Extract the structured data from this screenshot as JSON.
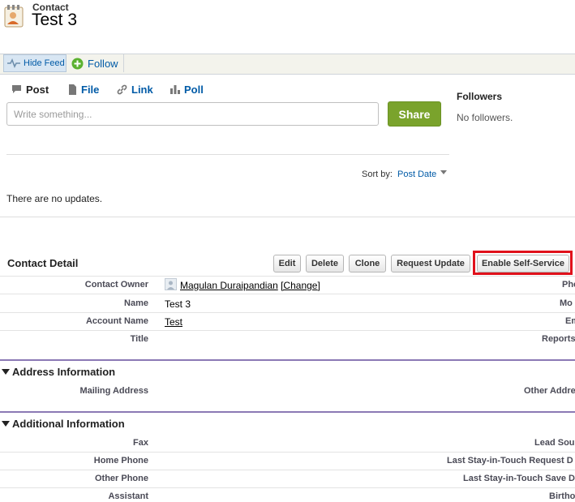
{
  "header": {
    "object_type": "Contact",
    "title": "Test 3"
  },
  "feed_bar": {
    "hide_feed": "Hide Feed",
    "follow": "Follow"
  },
  "publisher": {
    "tabs": [
      {
        "label": "Post"
      },
      {
        "label": "File"
      },
      {
        "label": "Link"
      },
      {
        "label": "Poll"
      }
    ],
    "placeholder": "Write something...",
    "share_label": "Share"
  },
  "followers": {
    "title": "Followers",
    "empty_text": "No followers."
  },
  "feed": {
    "sort_label": "Sort by:",
    "sort_value": "Post Date",
    "empty_text": "There are no updates."
  },
  "detail": {
    "title": "Contact Detail",
    "buttons": {
      "edit": "Edit",
      "delete": "Delete",
      "clone": "Clone",
      "request_update": "Request Update",
      "enable_self_service": "Enable Self-Service"
    },
    "fields": {
      "owner_label": "Contact Owner",
      "owner_value": "Magulan Duraipandian",
      "owner_change": "[Change]",
      "name_label": "Name",
      "name_value": "Test 3",
      "account_label": "Account Name",
      "account_value": "Test",
      "title_label": "Title"
    },
    "right_labels": {
      "phone": "Pho",
      "mobile": "Mo",
      "email": "Em",
      "reports_to": "Reports"
    }
  },
  "address_section": {
    "title": "Address Information",
    "mailing_label": "Mailing Address",
    "other_label": "Other Addre"
  },
  "additional_section": {
    "title": "Additional Information",
    "left_labels": {
      "fax": "Fax",
      "home_phone": "Home Phone",
      "other_phone": "Other Phone",
      "assistant": "Assistant"
    },
    "right_labels": {
      "lead_source": "Lead Sou",
      "last_request": "Last Stay-in-Touch Request D",
      "last_save": "Last Stay-in-Touch Save D",
      "birthdate": "Birtho"
    }
  },
  "colors": {
    "link": "#015ba7",
    "share": "#7aa32c",
    "highlight": "#e0111b",
    "section_rule": "#8b79b5"
  }
}
